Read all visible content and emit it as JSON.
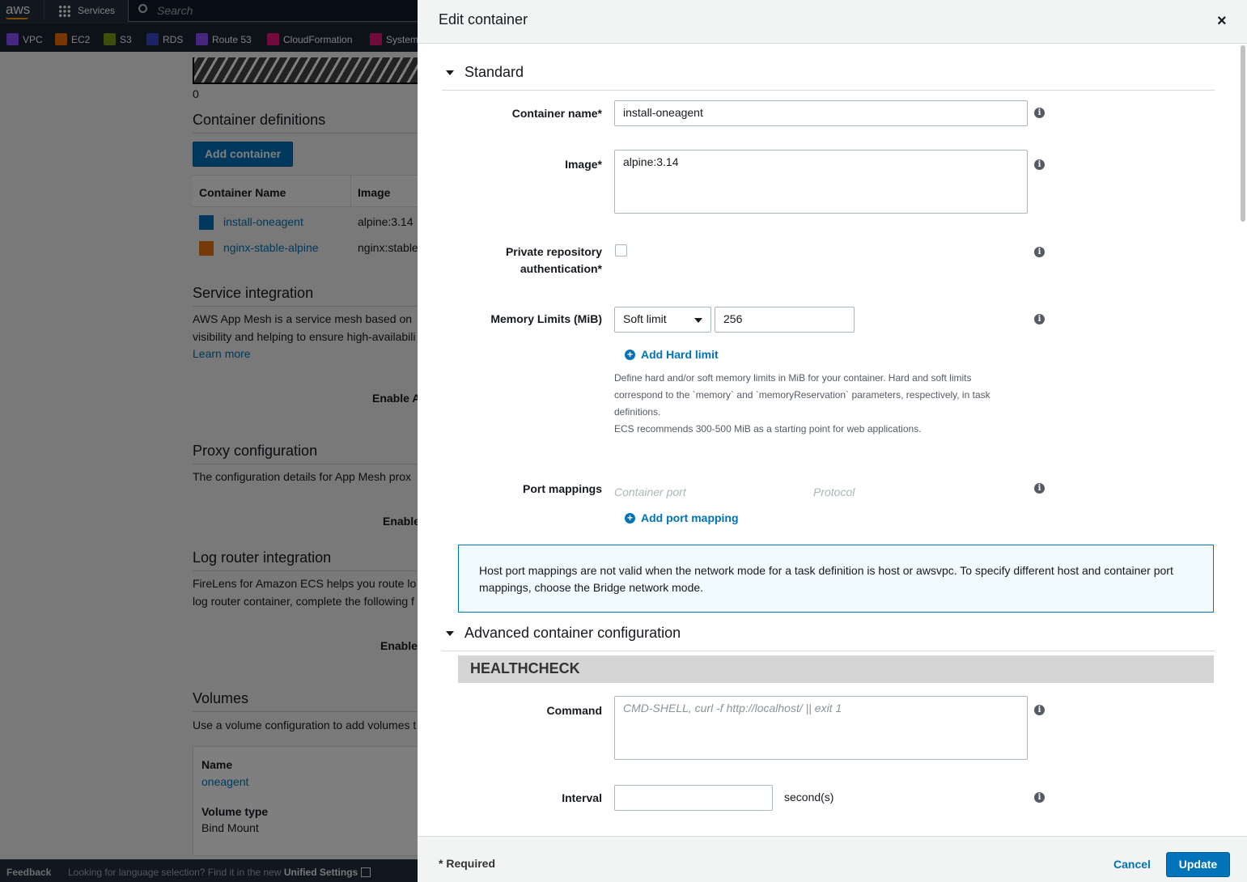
{
  "topnav": {
    "logo": "aws",
    "services": "Services",
    "search_placeholder": "Search"
  },
  "favorites": [
    {
      "label": "VPC",
      "color": "#8c4fff"
    },
    {
      "label": "EC2",
      "color": "#ed7100"
    },
    {
      "label": "S3",
      "color": "#7aa116"
    },
    {
      "label": "RDS",
      "color": "#3b48cc"
    },
    {
      "label": "Route 53",
      "color": "#8c4fff"
    },
    {
      "label": "CloudFormation",
      "color": "#e7157b"
    },
    {
      "label": "System",
      "color": "#e7157b"
    }
  ],
  "background": {
    "progress_value": "0",
    "container_definitions": {
      "title": "Container definitions",
      "add_button": "Add container",
      "columns": [
        "Container Name",
        "Image"
      ],
      "rows": [
        {
          "name": "install-oneagent",
          "image": "alpine:3.14",
          "color": "#0073bb"
        },
        {
          "name": "nginx-stable-alpine",
          "image": "nginx:stable",
          "color": "#ec7211"
        }
      ]
    },
    "service_integration": {
      "title": "Service integration",
      "text1": "AWS App Mesh is a service mesh based on",
      "text2": "visibility and helping to ensure high-availabili",
      "learn_more": "Learn more",
      "enable": "Enable A"
    },
    "proxy": {
      "title": "Proxy configuration",
      "text": "The configuration details for App Mesh prox",
      "enable": "Enable"
    },
    "log_router": {
      "title": "Log router integration",
      "text1": "FireLens for Amazon ECS helps you route lo",
      "text2": "log router container, complete the following f",
      "enable": "Enable"
    },
    "volumes": {
      "title": "Volumes",
      "text": "Use a volume configuration to add volumes t",
      "name_label": "Name",
      "name_value": "oneagent",
      "type_label": "Volume type",
      "type_value": "Bind Mount"
    }
  },
  "footer": {
    "feedback": "Feedback",
    "language": "Looking for language selection? Find it in the new",
    "unified": "Unified Settings"
  },
  "modal": {
    "title": "Edit container",
    "standard": "Standard",
    "container_name_label": "Container name*",
    "container_name": "install-oneagent",
    "image_label": "Image*",
    "image": "alpine:3.14",
    "private_repo_label1": "Private repository",
    "private_repo_label2": "authentication*",
    "private_repo_checked": false,
    "memory_label": "Memory Limits (MiB)",
    "memory_type": "Soft limit",
    "memory_value": "256",
    "add_hard_limit": "Add Hard limit",
    "memory_help": [
      "Define hard and/or soft memory limits in MiB for your container. Hard and soft limits",
      "correspond to the `memory` and `memoryReservation` parameters, respectively, in task",
      "definitions.",
      "ECS recommends 300-500 MiB as a starting point for web applications."
    ],
    "port_label": "Port mappings",
    "port_container_placeholder": "Container port",
    "port_protocol_placeholder": "Protocol",
    "add_port_mapping": "Add port mapping",
    "port_alert": "Host port mappings are not valid when the network mode for a task definition is host or awsvpc. To specify different host and container port mappings, choose the Bridge network mode.",
    "advanced": "Advanced container configuration",
    "healthcheck": "HEALTHCHECK",
    "command_label": "Command",
    "command_placeholder": "CMD-SHELL, curl -f http://localhost/ || exit 1",
    "interval_label": "Interval",
    "interval_unit": "second(s)",
    "interval_value": "",
    "required_note": "* Required",
    "cancel": "Cancel",
    "update": "Update"
  }
}
